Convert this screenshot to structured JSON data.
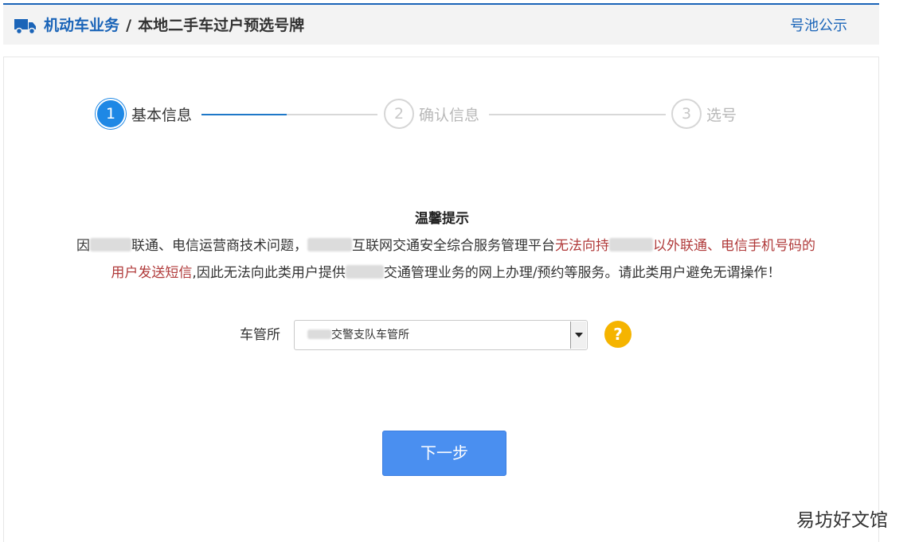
{
  "header": {
    "icon": "truck-icon",
    "section_link": "机动车业务",
    "separator": "/",
    "current_page": "本地二手车过户预选号牌",
    "pool_link": "号池公示",
    "accent_color": "#1a64b8"
  },
  "steps": [
    {
      "number": "1",
      "label": "基本信息",
      "state": "active"
    },
    {
      "number": "2",
      "label": "确认信息",
      "state": "inactive"
    },
    {
      "number": "3",
      "label": "选号",
      "state": "inactive"
    }
  ],
  "notice": {
    "title": "温馨提示",
    "part1": "因",
    "part2": "联通、电信运营商技术问题，",
    "part3": "互联网交通安全综合服务管理平台",
    "red1": "无法向持",
    "red2": "以外联通、电信手机号码的",
    "red3": "用户发送短信",
    "part4": ",因此无法向此类用户提供",
    "part5": "交通管理业务的网上办理/预约等服务。请此类用户避免无谓操作！"
  },
  "form": {
    "office_label": "车管所",
    "office_value": "交警支队车管所",
    "help_icon": "question-icon",
    "help_text": "?"
  },
  "actions": {
    "next_label": "下一步"
  },
  "watermark": "易坊好文馆"
}
